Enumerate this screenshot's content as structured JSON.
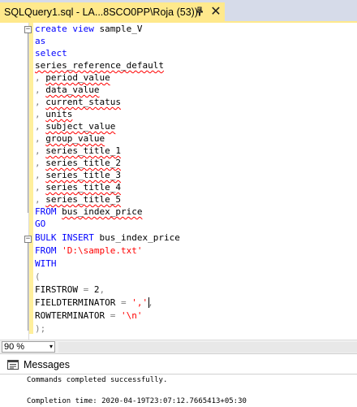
{
  "tab": {
    "title": "SQLQuery1.sql - LA...8SCO0PP\\Roja (53))*",
    "pin_icon": "pin-icon",
    "close_icon": "close-icon",
    "close_glyph": "✕"
  },
  "editor": {
    "lines": [
      "create view sample_V",
      "as",
      "select",
      "series_reference_default",
      ", period_value",
      ", data_value",
      ", current_status",
      ", units",
      ", subject_value",
      ", group_value",
      ", series_title_1",
      ", series_title_2",
      ", series_title_3",
      ", series_title_4",
      ", series_title_5",
      "FROM bus_index_price",
      "GO",
      "BULK INSERT bus_index_price",
      "FROM 'D:\\sample.txt'",
      "WITH",
      "(",
      "FIRSTROW = 2,",
      "FIELDTERMINATOR = ',',",
      "ROWTERMINATOR = '\\n'",
      ");"
    ],
    "fold_collapse_glyph": "−"
  },
  "zoom": {
    "value": "90 %",
    "options_arrow": "▾"
  },
  "messages": {
    "tab_label": "Messages",
    "line1": "Commands completed successfully.",
    "line2": "Completion time: 2020-04-19T23:07:12.7665413+05:30"
  },
  "colors": {
    "tab_active": "#ffe98c",
    "keyword": "#0000ff",
    "string": "#ff0000",
    "squiggle": "#ff0000"
  }
}
